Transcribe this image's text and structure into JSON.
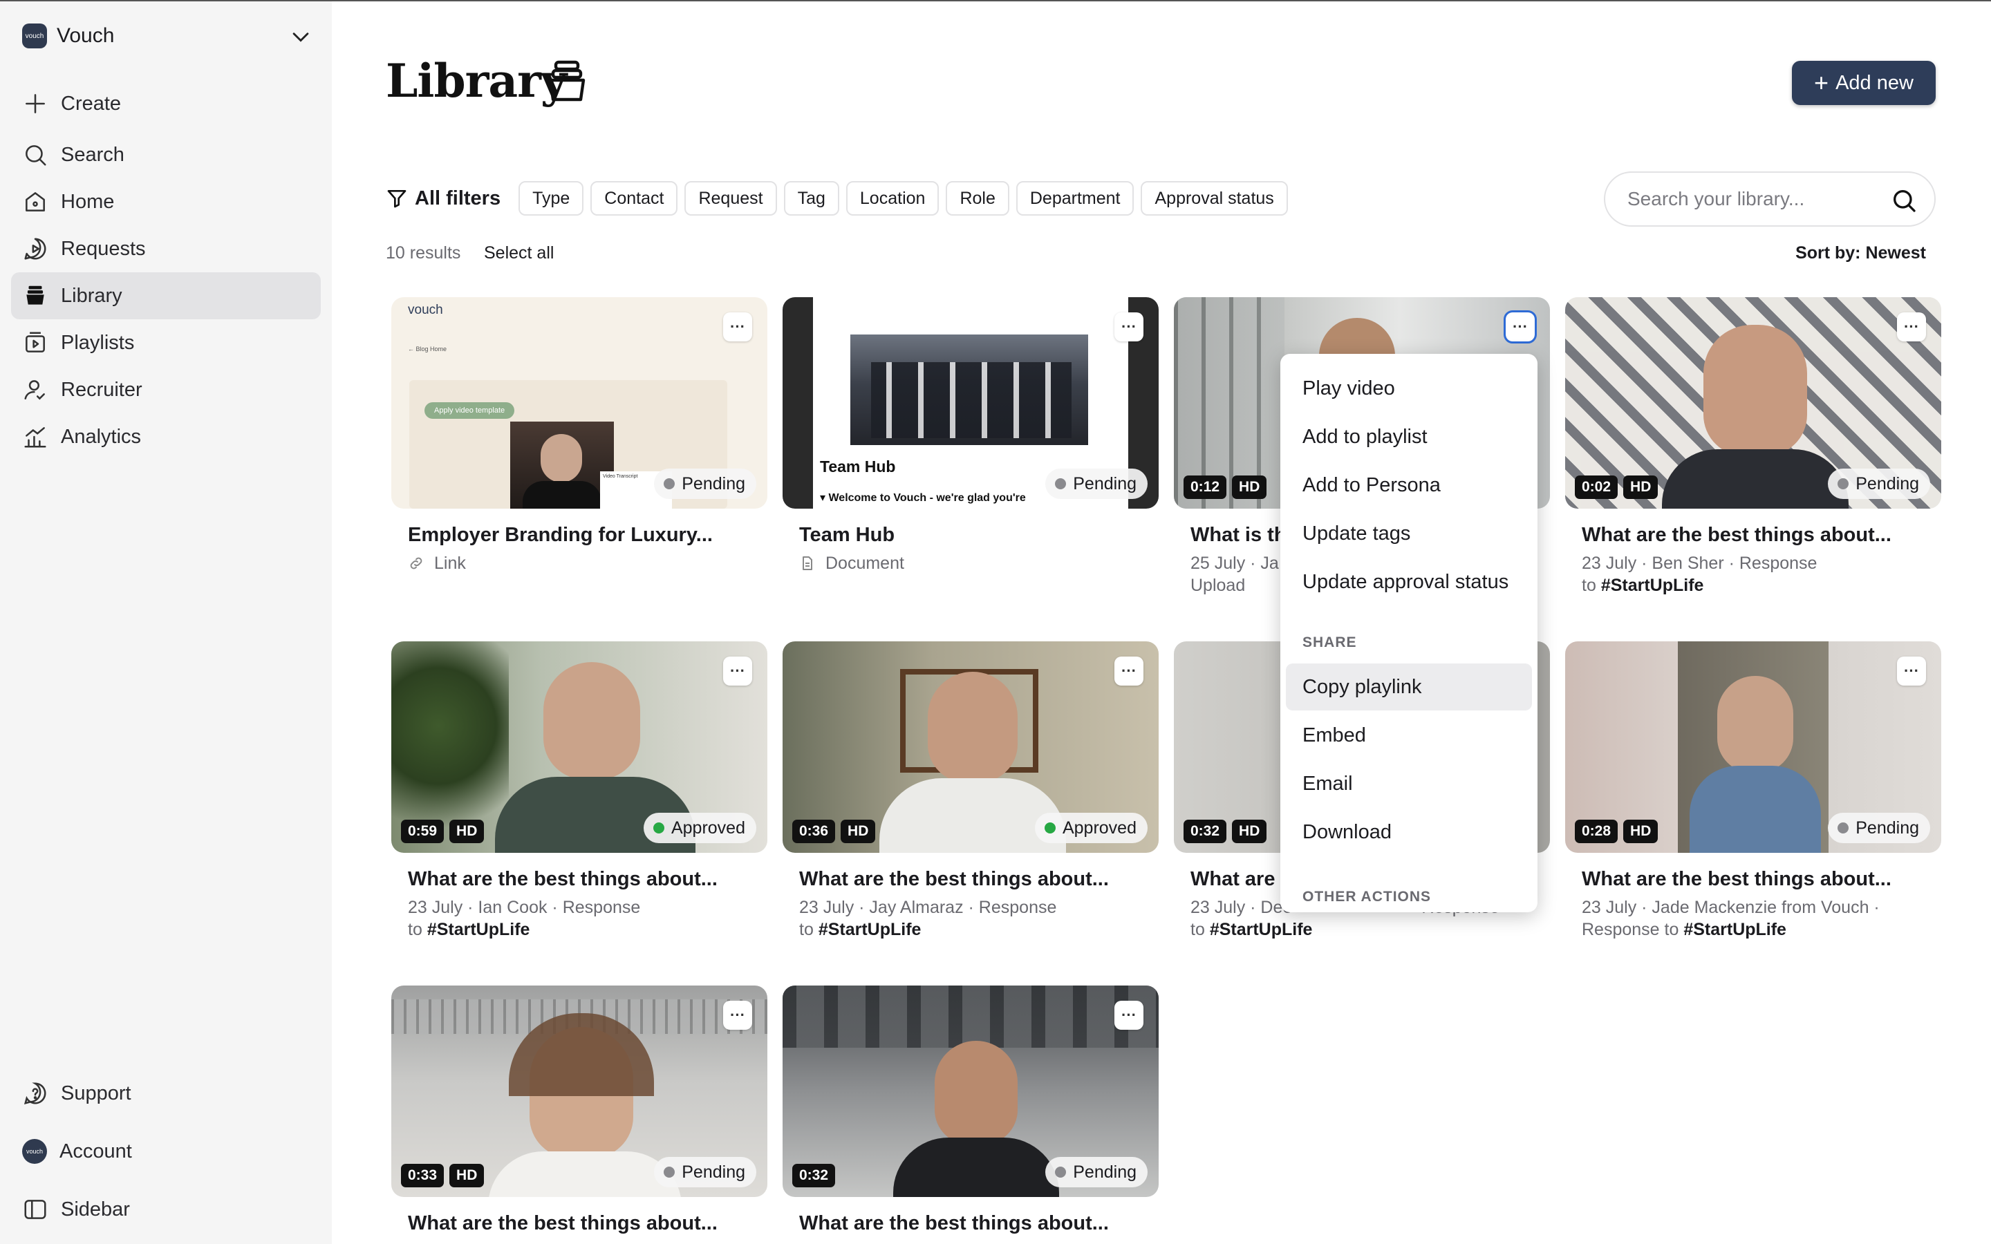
{
  "workspace": {
    "logo_text": "vouch",
    "name": "Vouch"
  },
  "nav": {
    "create": "Create",
    "search": "Search",
    "home": "Home",
    "requests": "Requests",
    "library": "Library",
    "playlists": "Playlists",
    "recruiter": "Recruiter",
    "analytics": "Analytics",
    "support": "Support",
    "account": "Account",
    "sidebar": "Sidebar"
  },
  "header": {
    "title": "Library",
    "add_new": "Add new"
  },
  "filters": {
    "all": "All filters",
    "chips": [
      "Type",
      "Contact",
      "Request",
      "Tag",
      "Location",
      "Role",
      "Department",
      "Approval status"
    ]
  },
  "search": {
    "placeholder": "Search your library..."
  },
  "results": {
    "count": "10 results",
    "select_all": "Select all",
    "sort": "Sort by: Newest"
  },
  "cards": [
    {
      "title": "Employer Branding for Luxury...",
      "meta_type": "Link",
      "status": "Pending",
      "thumb_brand": "vouch",
      "thumb_link": "← Blog Home",
      "thumb_button": "Apply video template",
      "thumb_caption": "Video Transcript"
    },
    {
      "title": "Team Hub",
      "meta_type": "Document",
      "status": "Pending",
      "thumb_heading": "Team Hub",
      "thumb_caption": "▾ Welcome to Vouch - we're glad you're"
    },
    {
      "title": "What is th",
      "duration": "0:12",
      "quality": "HD",
      "meta_line1": "25 July · Ja",
      "meta_line2": "Upload"
    },
    {
      "title": "What are the best things about...",
      "duration": "0:02",
      "quality": "HD",
      "status": "Pending",
      "meta": "23 July · Ben Sher · Response",
      "to": "to",
      "tag": "#StartUpLife"
    },
    {
      "title": "What are the best things about...",
      "duration": "0:59",
      "quality": "HD",
      "status": "Approved",
      "meta": "23 July · Ian Cook · Response",
      "to": "to",
      "tag": "#StartUpLife"
    },
    {
      "title": "What are the best things about...",
      "duration": "0:36",
      "quality": "HD",
      "status": "Approved",
      "meta": "23 July · Jay Almaraz · Response",
      "to": "to",
      "tag": "#StartUpLife"
    },
    {
      "title": "What are t",
      "duration": "0:32",
      "quality": "HD",
      "meta": "23 July · Dee",
      "meta_tail": "Response",
      "to": "to",
      "tag": "#StartUpLife"
    },
    {
      "title": "What are the best things about...",
      "duration": "0:28",
      "quality": "HD",
      "status": "Pending",
      "meta": "23 July · Jade Mackenzie from Vouch ·",
      "to": "Response to",
      "tag": "#StartUpLife"
    },
    {
      "title": "What are the best things about...",
      "duration": "0:33",
      "quality": "HD",
      "status": "Pending"
    },
    {
      "title": "What are the best things about...",
      "duration": "0:32",
      "status": "Pending"
    }
  ],
  "menu": {
    "items": [
      "Play video",
      "Add to playlist",
      "Add to Persona",
      "Update tags",
      "Update approval status"
    ],
    "share_heading": "SHARE",
    "share_items": [
      "Copy playlink",
      "Embed",
      "Email",
      "Download"
    ],
    "other_heading": "OTHER ACTIONS"
  },
  "colors": {
    "primary": "#2e3d59",
    "approved": "#27a844",
    "pending": "#8a8a8e",
    "sidebar_bg": "#f5f5f5"
  }
}
